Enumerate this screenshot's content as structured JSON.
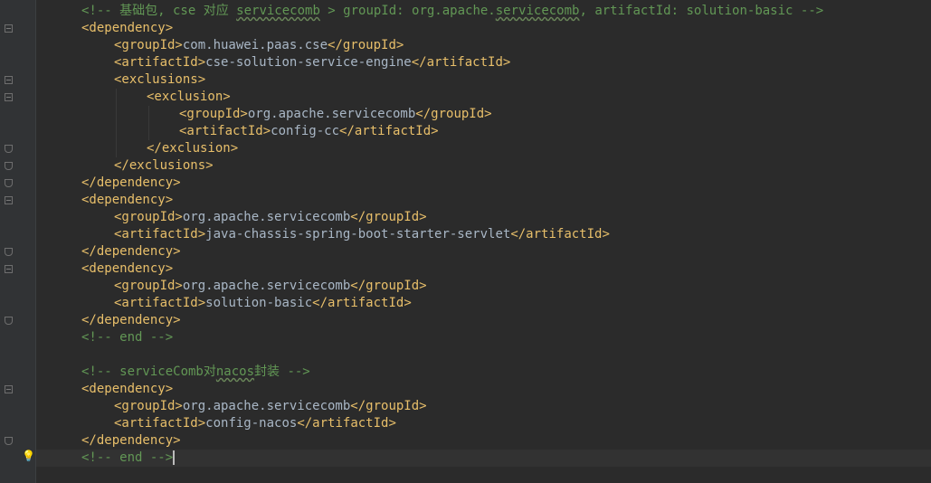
{
  "editor": {
    "lines": [
      {
        "indent": 0,
        "parts": [
          {
            "t": "<!-- 基础包, cse 对应 ",
            "k": "comment"
          },
          {
            "t": "servicecomb",
            "k": "comment",
            "typo": true
          },
          {
            "t": " > groupId: org.apache.",
            "k": "comment"
          },
          {
            "t": "servicecomb",
            "k": "comment",
            "typo": true
          },
          {
            "t": ", artifactId: solution-basic -->",
            "k": "comment"
          }
        ]
      },
      {
        "indent": 0,
        "parts": [
          {
            "t": "<dependency>",
            "k": "tag"
          }
        ]
      },
      {
        "indent": 1,
        "parts": [
          {
            "t": "<groupId>",
            "k": "tag"
          },
          {
            "t": "com.huawei.paas.cse",
            "k": "text"
          },
          {
            "t": "</groupId>",
            "k": "tag"
          }
        ]
      },
      {
        "indent": 1,
        "parts": [
          {
            "t": "<artifactId>",
            "k": "tag"
          },
          {
            "t": "cse-solution-service-engine",
            "k": "text"
          },
          {
            "t": "</artifactId>",
            "k": "tag"
          }
        ]
      },
      {
        "indent": 1,
        "parts": [
          {
            "t": "<exclusions>",
            "k": "tag"
          }
        ]
      },
      {
        "indent": 2,
        "parts": [
          {
            "t": "<exclusion>",
            "k": "tag"
          }
        ]
      },
      {
        "indent": 3,
        "parts": [
          {
            "t": "<groupId>",
            "k": "tag"
          },
          {
            "t": "org.apache.servicecomb",
            "k": "text"
          },
          {
            "t": "</groupId>",
            "k": "tag"
          }
        ]
      },
      {
        "indent": 3,
        "parts": [
          {
            "t": "<artifactId>",
            "k": "tag"
          },
          {
            "t": "config-cc",
            "k": "text"
          },
          {
            "t": "</artifactId>",
            "k": "tag"
          }
        ]
      },
      {
        "indent": 2,
        "parts": [
          {
            "t": "</exclusion>",
            "k": "tag"
          }
        ]
      },
      {
        "indent": 1,
        "parts": [
          {
            "t": "</exclusions>",
            "k": "tag"
          }
        ]
      },
      {
        "indent": 0,
        "parts": [
          {
            "t": "</dependency>",
            "k": "tag"
          }
        ]
      },
      {
        "indent": 0,
        "parts": [
          {
            "t": "<dependency>",
            "k": "tag"
          }
        ]
      },
      {
        "indent": 1,
        "parts": [
          {
            "t": "<groupId>",
            "k": "tag"
          },
          {
            "t": "org.apache.servicecomb",
            "k": "text"
          },
          {
            "t": "</groupId>",
            "k": "tag"
          }
        ]
      },
      {
        "indent": 1,
        "parts": [
          {
            "t": "<artifactId>",
            "k": "tag"
          },
          {
            "t": "java-chassis-spring-boot-starter-servlet",
            "k": "text"
          },
          {
            "t": "</artifactId>",
            "k": "tag"
          }
        ]
      },
      {
        "indent": 0,
        "parts": [
          {
            "t": "</dependency>",
            "k": "tag"
          }
        ]
      },
      {
        "indent": 0,
        "parts": [
          {
            "t": "<dependency>",
            "k": "tag"
          }
        ]
      },
      {
        "indent": 1,
        "parts": [
          {
            "t": "<groupId>",
            "k": "tag"
          },
          {
            "t": "org.apache.servicecomb",
            "k": "text"
          },
          {
            "t": "</groupId>",
            "k": "tag"
          }
        ]
      },
      {
        "indent": 1,
        "parts": [
          {
            "t": "<artifactId>",
            "k": "tag"
          },
          {
            "t": "solution-basic",
            "k": "text"
          },
          {
            "t": "</artifactId>",
            "k": "tag"
          }
        ]
      },
      {
        "indent": 0,
        "parts": [
          {
            "t": "</dependency>",
            "k": "tag"
          }
        ]
      },
      {
        "indent": 0,
        "parts": [
          {
            "t": "<!-- end -->",
            "k": "comment"
          }
        ]
      },
      {
        "indent": 0,
        "parts": []
      },
      {
        "indent": 0,
        "parts": [
          {
            "t": "<!-- serviceComb对",
            "k": "comment"
          },
          {
            "t": "nacos",
            "k": "comment",
            "typo": true
          },
          {
            "t": "封装 -->",
            "k": "comment"
          }
        ]
      },
      {
        "indent": 0,
        "parts": [
          {
            "t": "<dependency>",
            "k": "tag"
          }
        ]
      },
      {
        "indent": 1,
        "parts": [
          {
            "t": "<groupId>",
            "k": "tag"
          },
          {
            "t": "org.apache.servicecomb",
            "k": "text"
          },
          {
            "t": "</groupId>",
            "k": "tag"
          }
        ]
      },
      {
        "indent": 1,
        "parts": [
          {
            "t": "<artifactId>",
            "k": "tag"
          },
          {
            "t": "config-nacos",
            "k": "text"
          },
          {
            "t": "</artifactId>",
            "k": "tag"
          }
        ]
      },
      {
        "indent": 0,
        "parts": [
          {
            "t": "</dependency>",
            "k": "tag"
          }
        ]
      },
      {
        "indent": 0,
        "parts": [
          {
            "t": "<!-- end -->",
            "k": "comment"
          }
        ],
        "current": true,
        "caret": true
      }
    ],
    "folds": [
      {
        "line": 1,
        "kind": "open"
      },
      {
        "line": 4,
        "kind": "open"
      },
      {
        "line": 5,
        "kind": "open"
      },
      {
        "line": 8,
        "kind": "close"
      },
      {
        "line": 9,
        "kind": "close"
      },
      {
        "line": 10,
        "kind": "close"
      },
      {
        "line": 11,
        "kind": "open"
      },
      {
        "line": 14,
        "kind": "close"
      },
      {
        "line": 15,
        "kind": "open"
      },
      {
        "line": 18,
        "kind": "close"
      },
      {
        "line": 22,
        "kind": "open"
      },
      {
        "line": 25,
        "kind": "close"
      }
    ],
    "intention_icon": "lightbulb-icon",
    "colors": {
      "background": "#2b2b2b",
      "gutter": "#313335",
      "comment": "#629755",
      "tag": "#e8bf6a",
      "text": "#a9b7c6"
    }
  }
}
